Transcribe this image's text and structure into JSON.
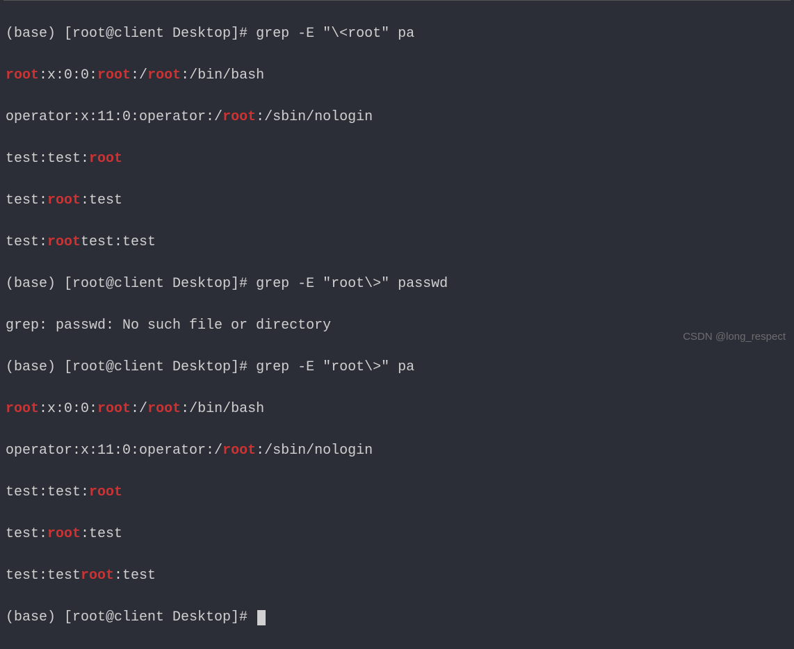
{
  "colors": {
    "bg": "#2b2e37",
    "fg": "#d0d0d0",
    "highlight": "#cc3333"
  },
  "watermark": "CSDN @long_respect",
  "prompt": "(base) [root@client Desktop]# ",
  "lines": {
    "l1_prompt": "(base) [root@client Desktop]# ",
    "l1_cmd": "grep -E \"\\<root\" pa",
    "l2_a": "root",
    "l2_b": ":x:0:0:",
    "l2_c": "root",
    "l2_d": ":/",
    "l2_e": "root",
    "l2_f": ":/bin/bash",
    "l3_a": "operator:x:11:0:operator:/",
    "l3_b": "root",
    "l3_c": ":/sbin/nologin",
    "l4_a": "test:test:",
    "l4_b": "root",
    "l5_a": "test:",
    "l5_b": "root",
    "l5_c": ":test",
    "l6_a": "test:",
    "l6_b": "root",
    "l6_c": "test:test",
    "l7_prompt": "(base) [root@client Desktop]# ",
    "l7_cmd": "grep -E \"root\\>\" passwd",
    "l8": "grep: passwd: No such file or directory",
    "l9_prompt": "(base) [root@client Desktop]# ",
    "l9_cmd": "grep -E \"root\\>\" pa",
    "l10_a": "root",
    "l10_b": ":x:0:0:",
    "l10_c": "root",
    "l10_d": ":/",
    "l10_e": "root",
    "l10_f": ":/bin/bash",
    "l11_a": "operator:x:11:0:operator:/",
    "l11_b": "root",
    "l11_c": ":/sbin/nologin",
    "l12_a": "test:test:",
    "l12_b": "root",
    "l13_a": "test:",
    "l13_b": "root",
    "l13_c": ":test",
    "l14_a": "test:test",
    "l14_b": "root",
    "l14_c": ":test",
    "l15_prompt": "(base) [root@client Desktop]# "
  }
}
